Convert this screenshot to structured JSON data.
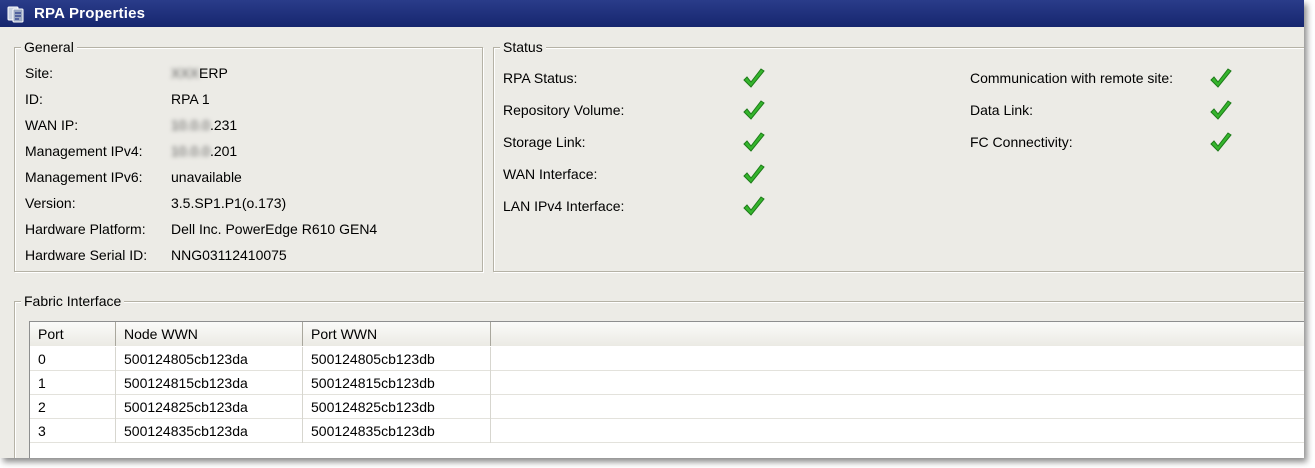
{
  "window": {
    "title": "RPA Properties"
  },
  "general": {
    "legend": "General",
    "rows": [
      {
        "label": "Site:",
        "value": "ERP",
        "blurred_prefix": "XXX"
      },
      {
        "label": "ID:",
        "value": "RPA 1"
      },
      {
        "label": "WAN IP:",
        "value": ".231",
        "blurred_prefix": "10.0.0"
      },
      {
        "label": "Management IPv4:",
        "value": ".201",
        "blurred_prefix": "10.0.0"
      },
      {
        "label": "Management IPv6:",
        "value": "unavailable"
      },
      {
        "label": "Version:",
        "value": "3.5.SP1.P1(o.173)"
      },
      {
        "label": "Hardware Platform:",
        "value": "Dell Inc. PowerEdge R610 GEN4"
      },
      {
        "label": "Hardware Serial ID:",
        "value": "NNG03112410075"
      }
    ]
  },
  "status": {
    "legend": "Status",
    "left_items": [
      {
        "label": "RPA Status:",
        "state": "ok"
      },
      {
        "label": "Repository Volume:",
        "state": "ok"
      },
      {
        "label": "Storage Link:",
        "state": "ok"
      },
      {
        "label": "WAN Interface:",
        "state": "ok"
      },
      {
        "label": "LAN IPv4 Interface:",
        "state": "ok"
      }
    ],
    "right_items": [
      {
        "label": "Communication with remote site:",
        "state": "ok"
      },
      {
        "label": "Data Link:",
        "state": "ok"
      },
      {
        "label": "FC Connectivity:",
        "state": "ok"
      }
    ],
    "ok_icon": "green-checkmark-icon",
    "ok_color": "#2fae2a"
  },
  "fabric": {
    "legend": "Fabric Interface",
    "columns": [
      "Port",
      "Node WWN",
      "Port WWN",
      ""
    ],
    "rows": [
      [
        "0",
        "500124805cb123da",
        "500124805cb123db"
      ],
      [
        "1",
        "500124815cb123da",
        "500124815cb123db"
      ],
      [
        "2",
        "500124825cb123da",
        "500124825cb123db"
      ],
      [
        "3",
        "500124835cb123da",
        "500124835cb123db"
      ]
    ]
  },
  "colors": {
    "titlebar": "#1b2b78",
    "window_bg": "#ecebe6"
  }
}
